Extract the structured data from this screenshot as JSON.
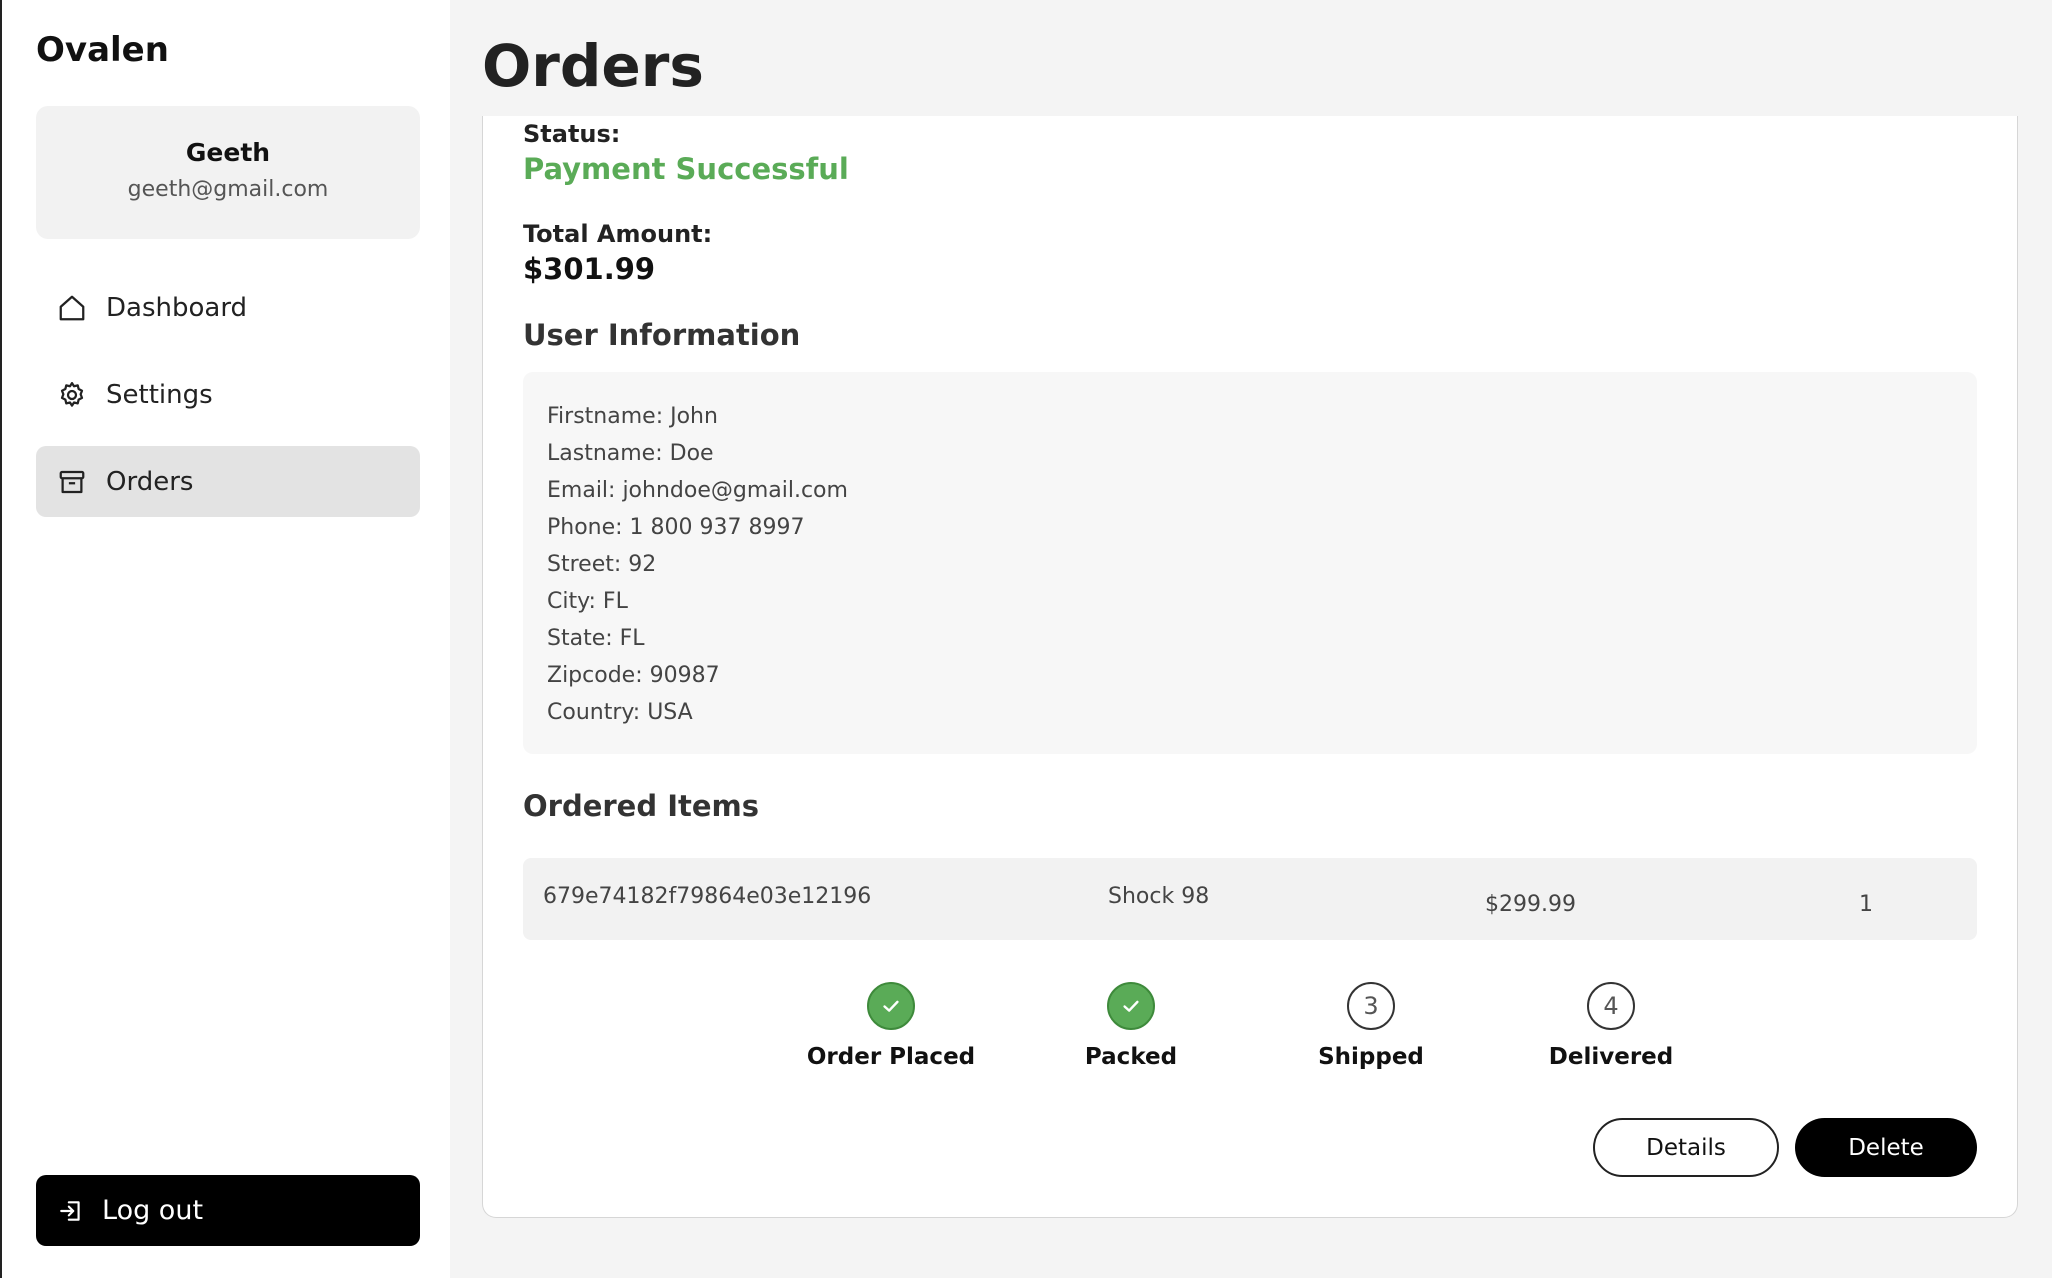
{
  "brand": "Ovalen",
  "user": {
    "name": "Geeth",
    "email": "geeth@gmail.com"
  },
  "nav": [
    {
      "label": "Dashboard",
      "icon": "home-icon",
      "active": false
    },
    {
      "label": "Settings",
      "icon": "gear-icon",
      "active": false
    },
    {
      "label": "Orders",
      "icon": "archive-box-icon",
      "active": true
    }
  ],
  "logout_label": "Log out",
  "page_title": "Orders",
  "order": {
    "status_label": "Status:",
    "status_value": "Payment Successful",
    "total_label": "Total Amount:",
    "total_value": "$301.99",
    "user_info_title": "User Information",
    "user_info": [
      "Firstname: John",
      "Lastname: Doe",
      "Email: johndoe@gmail.com",
      "Phone: 1 800 937 8997",
      "Street: 92",
      "City: FL",
      "State: FL",
      "Zipcode: 90987",
      "Country: USA"
    ],
    "items_title": "Ordered Items",
    "items": [
      {
        "id": "679e74182f79864e03e12196",
        "name": "Shock 98",
        "price": "$299.99",
        "qty": "1"
      }
    ],
    "steps": [
      {
        "label": "Order Placed",
        "number": "1",
        "done": true
      },
      {
        "label": "Packed",
        "number": "2",
        "done": true
      },
      {
        "label": "Shipped",
        "number": "3",
        "done": false
      },
      {
        "label": "Delivered",
        "number": "4",
        "done": false
      }
    ],
    "details_label": "Details",
    "delete_label": "Delete"
  },
  "colors": {
    "success": "#5aab57",
    "primary_button": "#000000",
    "active_nav": "#e3e3e3"
  }
}
